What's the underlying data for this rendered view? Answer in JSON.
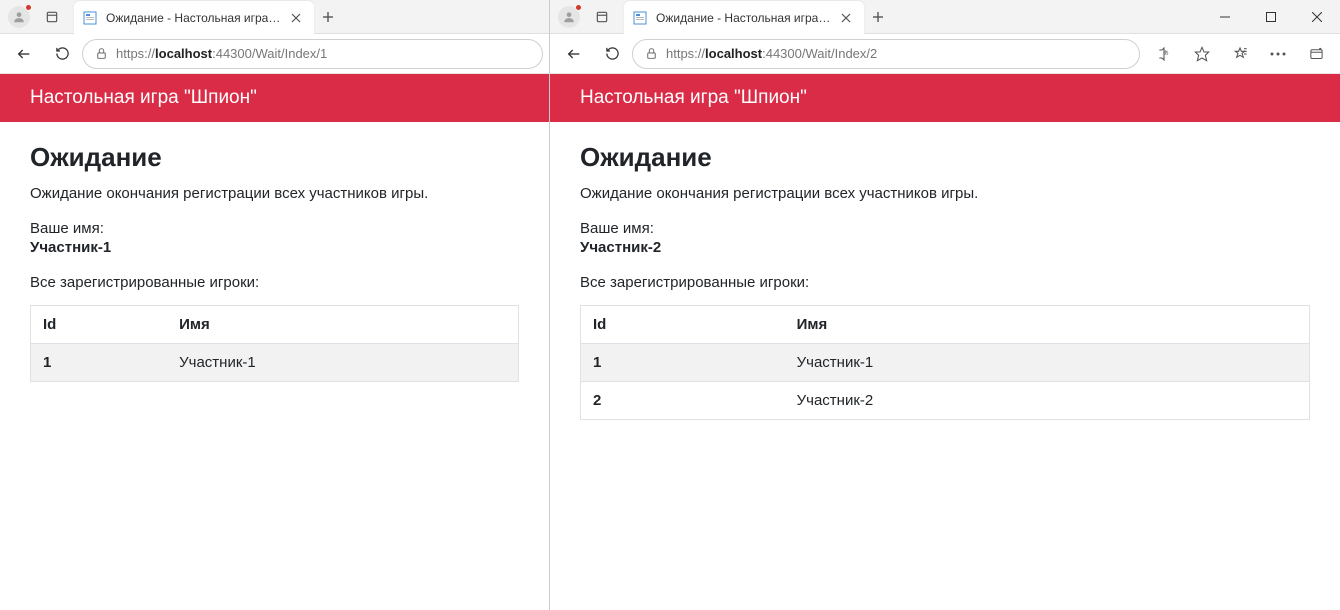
{
  "windows": [
    {
      "tab_title": "Ожидание - Настольная игра \"Ш",
      "url_prefix": "https://",
      "url_host": "localhost",
      "url_rest": ":44300/Wait/Index/1",
      "show_window_controls": false,
      "show_right_tools": false,
      "appbar_title": "Настольная игра \"Шпион\"",
      "page_heading": "Ожидание",
      "page_subtext": "Ожидание окончания регистрации всех участников игры.",
      "your_name_label": "Ваше имя:",
      "your_name_value": "Участник-1",
      "players_label": "Все зарегистрированные игроки:",
      "table_headers": {
        "id": "Id",
        "name": "Имя"
      },
      "players": [
        {
          "id": "1",
          "name": "Участник-1"
        }
      ]
    },
    {
      "tab_title": "Ожидание - Настольная игра \"Ш",
      "url_prefix": "https://",
      "url_host": "localhost",
      "url_rest": ":44300/Wait/Index/2",
      "show_window_controls": true,
      "show_right_tools": true,
      "appbar_title": "Настольная игра \"Шпион\"",
      "page_heading": "Ожидание",
      "page_subtext": "Ожидание окончания регистрации всех участников игры.",
      "your_name_label": "Ваше имя:",
      "your_name_value": "Участник-2",
      "players_label": "Все зарегистрированные игроки:",
      "table_headers": {
        "id": "Id",
        "name": "Имя"
      },
      "players": [
        {
          "id": "1",
          "name": "Участник-1"
        },
        {
          "id": "2",
          "name": "Участник-2"
        }
      ]
    }
  ]
}
